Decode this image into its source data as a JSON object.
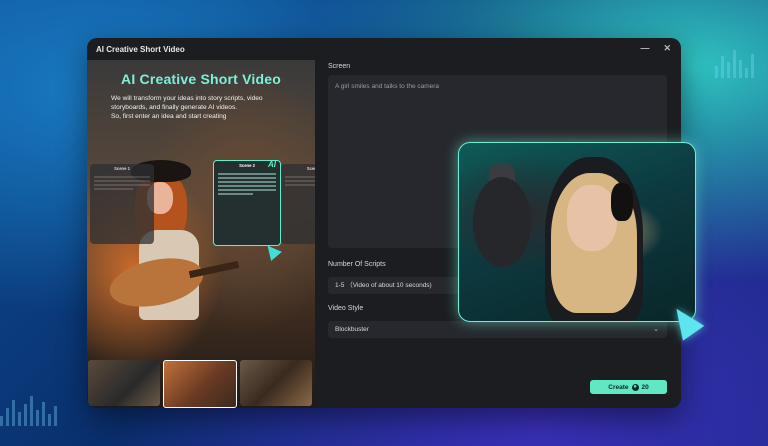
{
  "window": {
    "title": "AI Creative Short Video"
  },
  "hero": {
    "title": "AI Creative Short Video",
    "description_lines": [
      "We will transform your ideas into story scripts, video",
      "storyboards, and finally generate AI videos.",
      "So, first enter an idea and start creating"
    ]
  },
  "scene_cards": [
    {
      "label": "Scene 1"
    },
    {
      "label": "Scene 2",
      "badge": "AI"
    },
    {
      "label": "Scene"
    }
  ],
  "form": {
    "screen_label": "Screen",
    "screen_value": "A girl smiles and talks to the camera",
    "scripts_label": "Number Of Scripts",
    "scripts_value": "1-5 （Video of about 10 seconds)",
    "style_label": "Video Style",
    "style_value": "Blockbuster",
    "create_label": "Create",
    "create_cost": "20"
  },
  "icons": {
    "minimize": "minimize-icon",
    "close": "close-icon",
    "dropdown": "chevron-down-icon",
    "cost": "credit-coin-icon",
    "cursor": "pointer-cursor-icon"
  },
  "colors": {
    "accent": "#5fe8c3",
    "window_bg": "#1b1d21",
    "field_bg": "#26282d"
  }
}
